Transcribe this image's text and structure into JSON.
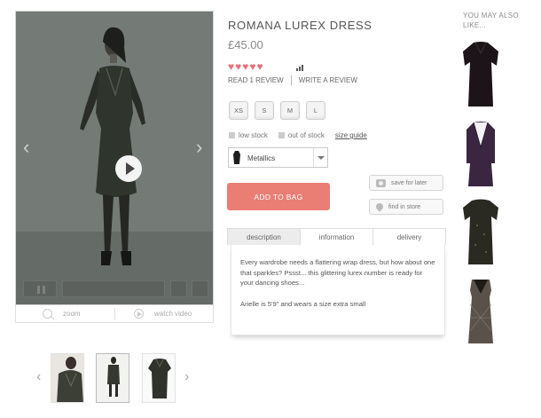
{
  "product": {
    "title": "ROMANA LUREX DRESS",
    "price": "£45.00",
    "rating": 5,
    "rating_max": 5,
    "read_reviews": "READ 1 REVIEW",
    "write_review": "WRITE A REVIEW"
  },
  "sizes": [
    "XS",
    "S",
    "M",
    "L"
  ],
  "stock_legend": {
    "low": "low stock",
    "out": "out of stock",
    "guide": "size guide"
  },
  "colour_select": {
    "selected": "Metallics",
    "swatch_color": "#1f1f1f"
  },
  "actions": {
    "add_to_bag": "ADD TO BAG",
    "save_for_later": "save for later",
    "find_in_store": "find in store"
  },
  "media_tools": {
    "zoom": "zoom",
    "watch_video": "watch video"
  },
  "tabs": [
    {
      "label": "description",
      "active": true
    },
    {
      "label": "information",
      "active": false
    },
    {
      "label": "delivery",
      "active": false
    }
  ],
  "description": {
    "para1": "Every wardrobe needs a flattering wrap dress, but how about one that sparkles? Pssst... this glittering lurex number is ready for your dancing shoes...",
    "para2": "Arielle is 5'9\" and wears a size extra small"
  },
  "recommendations": {
    "title": "YOU MAY ALSO LIKE...",
    "items": [
      {
        "name": "black-wrap-dress",
        "color": "#1c1418"
      },
      {
        "name": "purple-v-back-dress",
        "color": "#3a2640"
      },
      {
        "name": "black-sparkle-dress",
        "color": "#2b2a22"
      },
      {
        "name": "lace-overlay-dress",
        "color": "#5a524a"
      }
    ]
  },
  "colors": {
    "accent": "#ea7d74",
    "stars": "#ec6f79",
    "media_overlay": "#6b716c"
  }
}
